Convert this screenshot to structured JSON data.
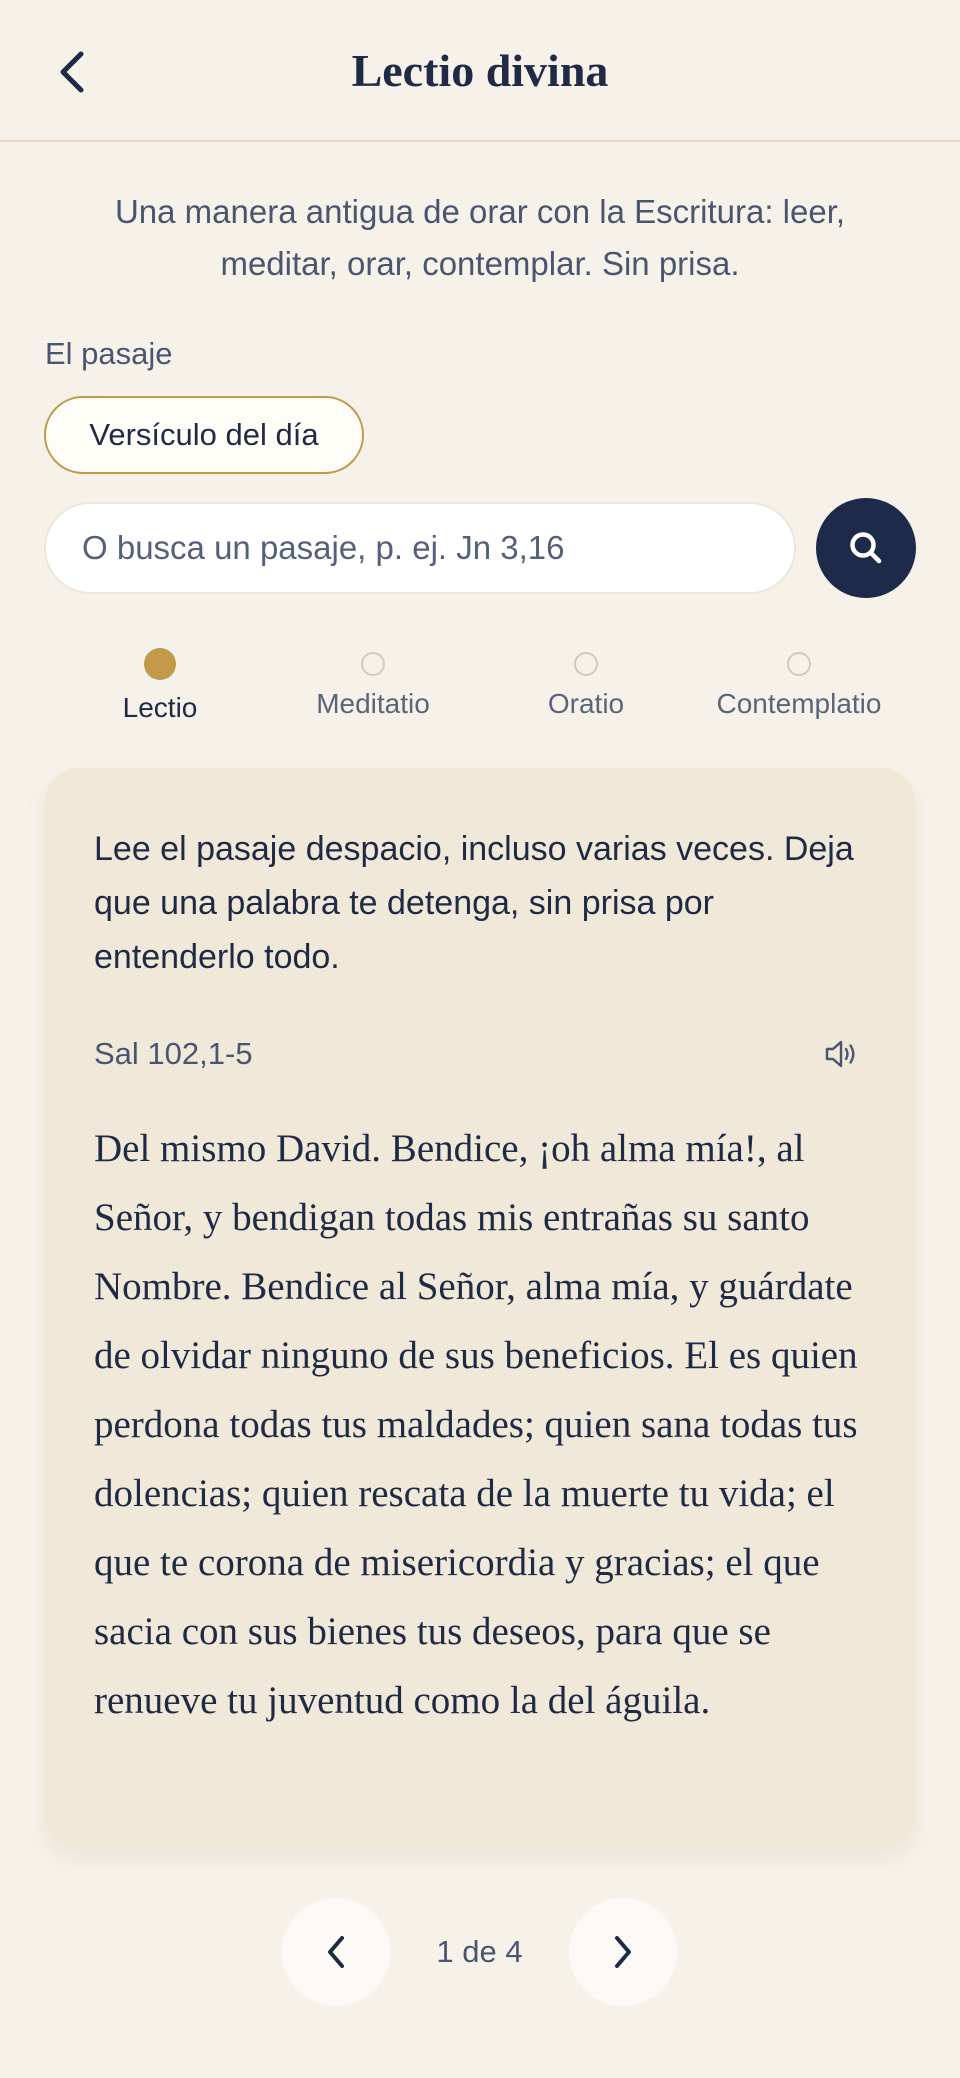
{
  "header": {
    "title": "Lectio divina",
    "back_icon": "chevron-left-icon"
  },
  "intro": "Una manera antigua de orar con la Escritura: leer, meditar, orar, contemplar. Sin prisa.",
  "passage_selector": {
    "label": "El pasaje",
    "verse_of_day_label": "Versículo del día",
    "search_placeholder": "O busca un pasaje, p. ej. Jn 3,16",
    "search_value": "",
    "search_icon": "search-icon"
  },
  "steps": [
    {
      "label": "Lectio",
      "active": true
    },
    {
      "label": "Meditatio",
      "active": false
    },
    {
      "label": "Oratio",
      "active": false
    },
    {
      "label": "Contemplatio",
      "active": false
    }
  ],
  "card": {
    "instruction": "Lee el pasaje despacio, incluso varias veces. Deja que una palabra te detenga, sin prisa por entenderlo todo.",
    "reference": "Sal 102,1-5",
    "speaker_icon": "speaker-icon",
    "passage": "Del mismo David. Bendice, ¡oh alma mía!, al Señor, y bendigan todas mis entrañas su santo Nombre. Bendice al Señor, alma mía, y guárdate de olvidar ninguno de sus beneficios. El es quien perdona todas tus maldades; quien sana todas tus dolencias; quien rescata de la muerte tu vida; el que te corona de misericordia y gracias; el que sacia con sus bienes tus deseos, para que se renueve tu juventud como la del águila."
  },
  "pager": {
    "text": "1 de 4",
    "current": 1,
    "total": 4,
    "prev_icon": "chevron-left-icon",
    "next_icon": "chevron-right-icon"
  },
  "colors": {
    "background": "#f6f2ea",
    "accent_gold": "#c29a4a",
    "navy": "#1e2a4a",
    "card_background": "#f0e8d8",
    "text_primary": "#1f2a44",
    "text_secondary": "#4a5670"
  }
}
